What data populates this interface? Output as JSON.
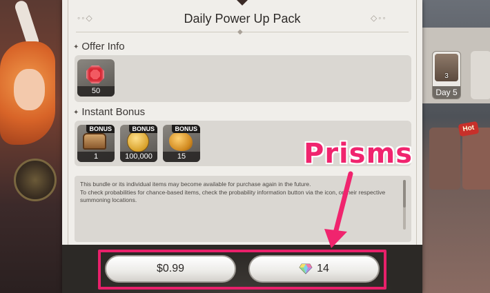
{
  "dialog": {
    "title": "Daily Power Up Pack",
    "offer_label": "Offer Info",
    "bonus_label": "Instant Bonus",
    "description_line1": "This bundle or its individual items may become available for purchase again in the future.",
    "description_line2": "To check probabilities for chance-based items, check the probability information button via the icon, or their respective summoning locations.",
    "offer_items": [
      {
        "icon": "red-gem-icon",
        "quantity": "50"
      }
    ],
    "bonus_items": [
      {
        "icon": "treasure-chest-icon",
        "badge": "BONUS",
        "quantity": "1"
      },
      {
        "icon": "gold-coin-icon",
        "badge": "BONUS",
        "quantity": "100,000"
      },
      {
        "icon": "gold-ore-icon",
        "badge": "BONUS",
        "quantity": "15"
      }
    ],
    "buttons": {
      "price_label": "$0.99",
      "prism_label": "14",
      "prism_icon": "prism-gem-icon"
    }
  },
  "background": {
    "day_card_count": "3",
    "day_card_label": "Day 5",
    "hot_badge": "Hot"
  },
  "annotation": {
    "label": "Prisms",
    "color": "#f0246e"
  }
}
